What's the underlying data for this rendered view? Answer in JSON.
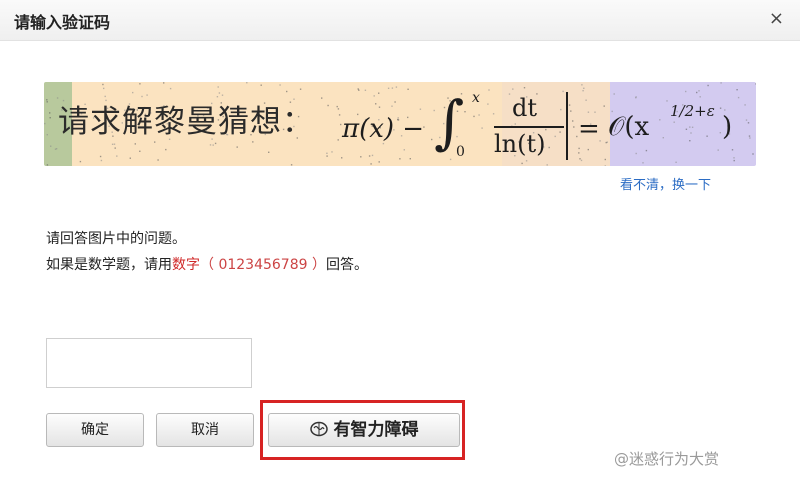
{
  "dialog": {
    "title": "请输入验证码",
    "close_glyph": "×"
  },
  "captcha": {
    "question": "请求解黎曼猜想：",
    "formula": {
      "lhs": "π(x) −",
      "integral": "∫",
      "upper": "x",
      "lower": "0",
      "numerator": "dt",
      "denominator": "ln(t)",
      "equals": "=",
      "big_o": "𝒪(x",
      "exponent": "1/2+ε",
      "close": ")"
    },
    "refresh_label": "看不清，换一下"
  },
  "instructions": {
    "line1": "请回答图片中的问题。",
    "line2_prefix": "如果是数学题，请用",
    "line2_highlight": "数字",
    "line2_digits": "（ 0123456789 ）",
    "line2_suffix": "回答。"
  },
  "answer": {
    "value": "",
    "placeholder": ""
  },
  "buttons": {
    "ok": "确定",
    "cancel": "取消",
    "idk_icon": "brain-icon",
    "idk": "有智力障碍"
  },
  "watermark": "@迷惑行为大赏",
  "colors": {
    "highlight": "#d72323",
    "link": "#2b6cc4",
    "emphasis": "#d02828"
  }
}
